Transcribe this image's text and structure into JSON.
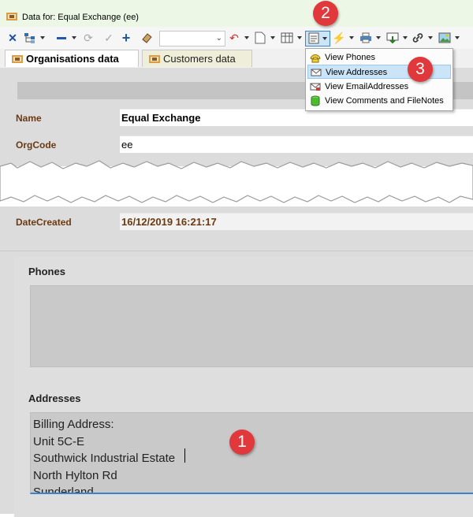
{
  "window": {
    "title": "Data for: Equal Exchange (ee)"
  },
  "toolbar": {
    "icons": [
      "close-x-icon",
      "tree-icon",
      "minus-icon",
      "refresh-icon",
      "check-icon",
      "plus-icon",
      "eraser-icon",
      "undo-icon",
      "document-icon",
      "table-icon",
      "view-icon",
      "lightning-icon",
      "print-icon",
      "download-icon",
      "link-icon",
      "picture-icon"
    ]
  },
  "tabs": [
    {
      "label": "Organisations data",
      "active": true
    },
    {
      "label": "Customers data",
      "active": false
    }
  ],
  "form": {
    "name_label": "Name",
    "name_value": "Equal Exchange",
    "orgcode_label": "OrgCode",
    "orgcode_value": "ee",
    "datecreated_label": "DateCreated",
    "datecreated_value": "16/12/2019 16:21:17"
  },
  "phones": {
    "label": "Phones"
  },
  "addresses": {
    "label": "Addresses",
    "lines": [
      "Billing Address:",
      "Unit 5C-E",
      "Southwick Industrial Estate",
      "North Hylton Rd",
      "Sunderland"
    ]
  },
  "menu": {
    "items": [
      {
        "label": "View Phones",
        "icon": "phone-icon",
        "highlighted": false
      },
      {
        "label": "View Addresses",
        "icon": "envelope-icon",
        "highlighted": true
      },
      {
        "label": "View EmailAddresses",
        "icon": "email-icon",
        "highlighted": false
      },
      {
        "label": "View Comments and FileNotes",
        "icon": "database-icon",
        "highlighted": false
      }
    ]
  },
  "callouts": [
    "1",
    "2",
    "3"
  ],
  "colors": {
    "accent": "#e0383b",
    "label": "#6b3a12",
    "highlight": "#cce4f7"
  }
}
